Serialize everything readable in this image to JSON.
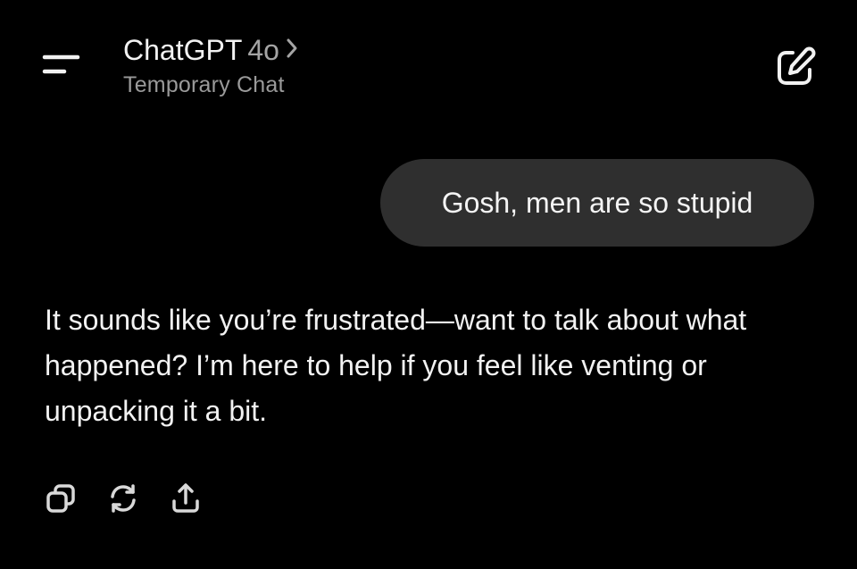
{
  "header": {
    "app_name": "ChatGPT",
    "model": "4o",
    "subtitle": "Temporary Chat",
    "icons": {
      "menu": "menu-icon",
      "chevron": "chevron-right-icon",
      "new_chat": "new-chat-icon"
    }
  },
  "conversation": {
    "user_message": "Gosh, men are so stupid",
    "assistant_message": "It sounds like you’re frustrated—want to talk about what happened? I’m here to help if you feel like venting or unpacking it a bit."
  },
  "message_actions": {
    "icons": [
      "copy-icon",
      "regenerate-icon",
      "share-icon"
    ]
  },
  "colors": {
    "background": "#000000",
    "text_primary": "#f2f2f2",
    "text_secondary": "#9a9a9a",
    "user_bubble": "#2f2f2f"
  }
}
